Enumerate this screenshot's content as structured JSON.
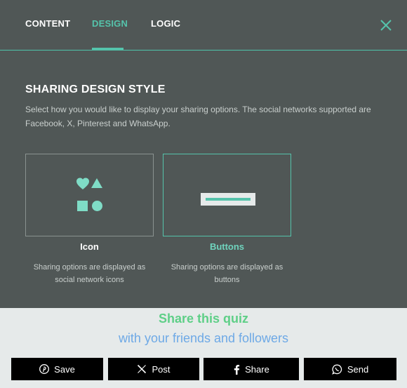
{
  "tabs": [
    {
      "label": "CONTENT",
      "active": false
    },
    {
      "label": "DESIGN",
      "active": true
    },
    {
      "label": "LOGIC",
      "active": false
    }
  ],
  "close_icon": "close-icon",
  "section": {
    "title": "SHARING DESIGN STYLE",
    "description": "Select how you would like to display your sharing options. The social networks supported are Facebook, X, Pinterest and WhatsApp."
  },
  "options": [
    {
      "label": "Icon",
      "description": "Sharing options are displayed as social network icons",
      "selected": false,
      "icon": "shapes-icon"
    },
    {
      "label": "Buttons",
      "description": "Sharing options are displayed as buttons",
      "selected": true,
      "icon": "button-preview-icon"
    }
  ],
  "preview": {
    "title": "Share this quiz",
    "subtitle": "with your friends and followers",
    "buttons": [
      {
        "label": "Save",
        "icon": "pinterest-icon"
      },
      {
        "label": "Post",
        "icon": "x-icon"
      },
      {
        "label": "Share",
        "icon": "facebook-icon"
      },
      {
        "label": "Send",
        "icon": "whatsapp-icon"
      }
    ]
  },
  "colors": {
    "accent": "#55c3ab",
    "panel_bg": "#505756",
    "preview_bg": "#e6eaea",
    "preview_title": "#5ecf87",
    "preview_subtitle": "#6ea9e6",
    "share_button_bg": "#000000"
  }
}
